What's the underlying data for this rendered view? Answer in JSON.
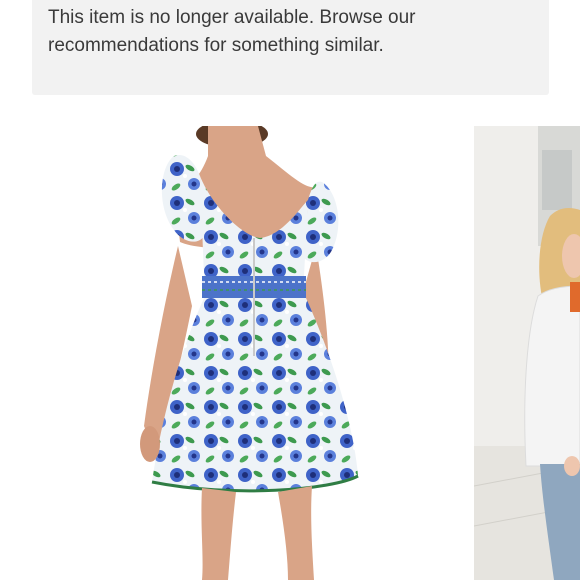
{
  "notice": {
    "line1": "This item is no longer available. Browse our",
    "line2": "recommendations for something similar."
  },
  "colors": {
    "notice_bg": "#f2f2f2",
    "text": "#3a3a3a",
    "dress_base": "#eef3f7",
    "flower_blue": "#3f63c8",
    "leaf_green": "#3d9a4f"
  },
  "images": {
    "main": "product-photo-floral-dress-back-view",
    "side": "product-photo-model-white-jacket"
  }
}
